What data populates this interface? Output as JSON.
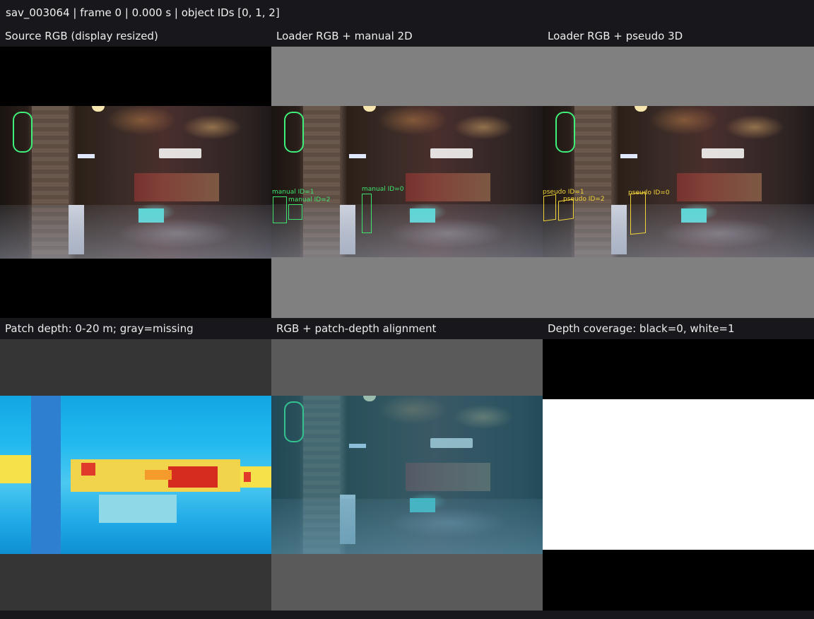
{
  "header": {
    "title": "sav_003064 | frame 0 | 0.000 s | object IDs [0, 1, 2]"
  },
  "panels": [
    {
      "label": "Source RGB (display resized)"
    },
    {
      "label": "Loader RGB + manual 2D"
    },
    {
      "label": "Loader RGB + pseudo 3D"
    },
    {
      "label": "Patch depth: 0-20 m; gray=missing"
    },
    {
      "label": "RGB + patch-depth alignment"
    },
    {
      "label": "Depth coverage: black=0, white=1"
    }
  ],
  "annotations": {
    "manual": [
      {
        "label": "manual ID=1"
      },
      {
        "label": "manual ID=2"
      },
      {
        "label": "manual ID=0"
      }
    ],
    "pseudo": [
      {
        "label": "pseudo ID=1"
      },
      {
        "label": "pseudo ID=2"
      },
      {
        "label": "pseudo ID=0"
      }
    ]
  },
  "colors": {
    "background": "#17171c",
    "manual_box": "#3fe36f",
    "pseudo_box": "#f2d43a",
    "missing_gray_dark": "#353535",
    "missing_gray_light": "#5a5a5a",
    "loader_pad_gray": "#808080"
  }
}
